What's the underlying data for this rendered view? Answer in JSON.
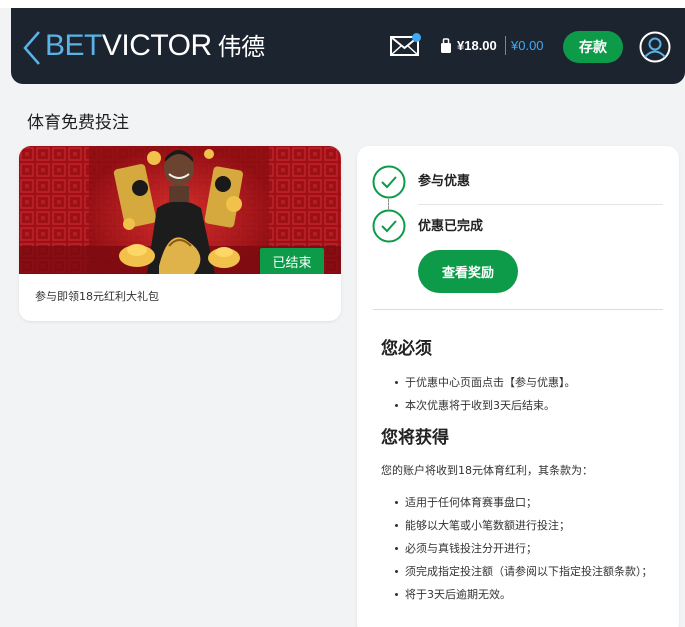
{
  "header": {
    "brand_bet": "BET",
    "brand_victor": "VICTOR",
    "brand_cn": "伟德",
    "balance_main": "¥18.00",
    "balance_bonus": "¥0.00",
    "deposit_label": "存款",
    "icons": [
      "back-chevron-icon",
      "mail-icon",
      "wallet-icon",
      "account-icon"
    ],
    "colors": {
      "bg": "#1c2430",
      "brand_blue": "#5ab2e6",
      "accent_green": "#0d9b4a",
      "notify_dot": "#3fa9f5"
    }
  },
  "page": {
    "title": "体育免费投注"
  },
  "promo": {
    "status_badge": "已结束",
    "caption": "参与即领18元红利大礼包"
  },
  "steps": [
    {
      "label": "参与优惠",
      "completed": true
    },
    {
      "label": "优惠已完成",
      "completed": true
    }
  ],
  "view_reward_label": "查看奖励",
  "requirements": {
    "title": "您必须",
    "items": [
      "于优惠中心页面点击【参与优惠】。",
      "本次优惠将于收到3天后结束。"
    ]
  },
  "rewards": {
    "title": "您将获得",
    "intro": "您的账户将收到18元体育红利，其条款为：",
    "items": [
      "适用于任何体育赛事盘口；",
      "能够以大笔或小笔数额进行投注；",
      "必须与真钱投注分开进行；",
      "须完成指定投注额（请参阅以下指定投注额条款）；",
      "将于3天后逾期无效。"
    ]
  }
}
